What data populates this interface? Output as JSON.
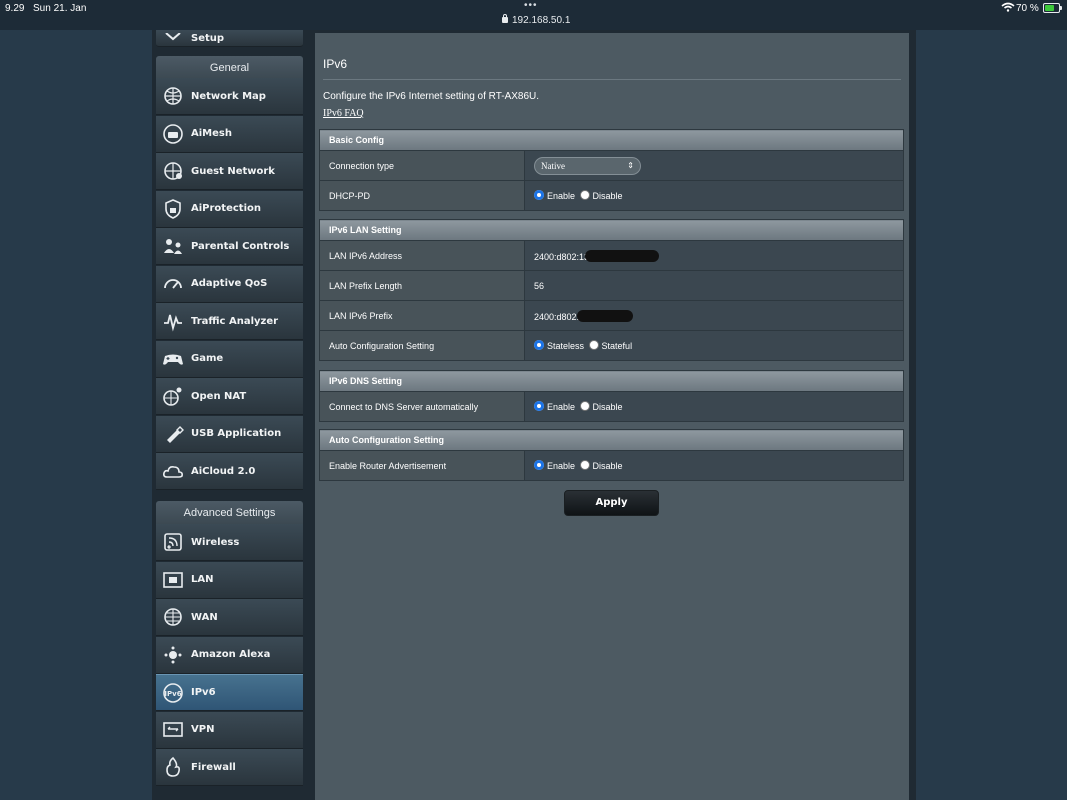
{
  "status_bar": {
    "time": "9.29",
    "date": "Sun 21. Jan",
    "url": "192.168.50.1",
    "battery_percent": "70 %",
    "battery_level": 0.7,
    "more_dots": "•••"
  },
  "sidebar": {
    "setup_label": "Setup",
    "general_header": "General",
    "general_items": [
      {
        "label": "Network Map",
        "icon": "network-map-icon"
      },
      {
        "label": "AiMesh",
        "icon": "aimesh-icon"
      },
      {
        "label": "Guest Network",
        "icon": "guest-network-icon"
      },
      {
        "label": "AiProtection",
        "icon": "aiprotection-icon"
      },
      {
        "label": "Parental Controls",
        "icon": "parental-controls-icon"
      },
      {
        "label": "Adaptive QoS",
        "icon": "adaptive-qos-icon"
      },
      {
        "label": "Traffic Analyzer",
        "icon": "traffic-analyzer-icon"
      },
      {
        "label": "Game",
        "icon": "game-icon"
      },
      {
        "label": "Open NAT",
        "icon": "open-nat-icon"
      },
      {
        "label": "USB Application",
        "icon": "usb-application-icon"
      },
      {
        "label": "AiCloud 2.0",
        "icon": "aicloud-icon"
      }
    ],
    "advanced_header": "Advanced Settings",
    "advanced_items": [
      {
        "label": "Wireless",
        "icon": "wireless-icon"
      },
      {
        "label": "LAN",
        "icon": "lan-icon"
      },
      {
        "label": "WAN",
        "icon": "wan-icon"
      },
      {
        "label": "Amazon Alexa",
        "icon": "alexa-icon"
      },
      {
        "label": "IPv6",
        "icon": "ipv6-icon",
        "active": true
      },
      {
        "label": "VPN",
        "icon": "vpn-icon"
      },
      {
        "label": "Firewall",
        "icon": "firewall-icon"
      }
    ]
  },
  "main": {
    "title": "IPv6",
    "description": "Configure the IPv6 Internet setting of RT-AX86U.",
    "faq_link": "IPv6 FAQ",
    "basic_config": {
      "header": "Basic Config",
      "connection_type_label": "Connection type",
      "connection_type_value": "Native",
      "dhcp_pd_label": "DHCP-PD",
      "dhcp_pd_enable": "Enable",
      "dhcp_pd_disable": "Disable"
    },
    "lan_setting": {
      "header": "IPv6 LAN Setting",
      "lan_ipv6_address_label": "LAN IPv6 Address",
      "lan_ipv6_address_value": "2400:d802:13",
      "lan_prefix_length_label": "LAN Prefix Length",
      "lan_prefix_length_value": "56",
      "lan_ipv6_prefix_label": "LAN IPv6 Prefix",
      "lan_ipv6_prefix_value": "2400:d802:",
      "auto_config_label": "Auto Configuration Setting",
      "auto_config_stateless": "Stateless",
      "auto_config_stateful": "Stateful"
    },
    "dns_setting": {
      "header": "IPv6 DNS Setting",
      "connect_dns_label": "Connect to DNS Server automatically",
      "enable": "Enable",
      "disable": "Disable"
    },
    "auto_config": {
      "header": "Auto Configuration Setting",
      "router_adv_label": "Enable Router Advertisement",
      "enable": "Enable",
      "disable": "Disable"
    },
    "apply_label": "Apply"
  },
  "colors": {
    "accent_radio": "#1a73e8",
    "active_nav": "#3a6585",
    "battery_fill": "#3ecb3c"
  }
}
